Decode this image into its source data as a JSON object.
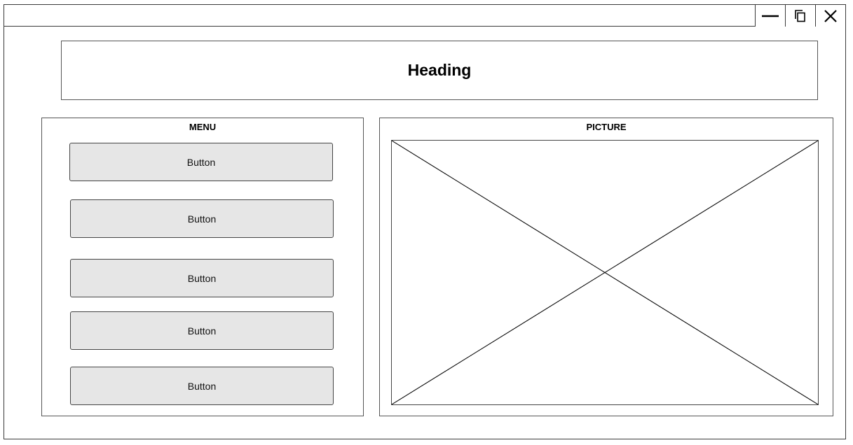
{
  "window": {
    "controls": {
      "minimize": "minimize-icon",
      "restore": "restore-icon",
      "close": "close-icon"
    }
  },
  "heading": {
    "text": "Heading"
  },
  "menu": {
    "title": "MENU",
    "buttons": [
      {
        "label": "Button"
      },
      {
        "label": "Button"
      },
      {
        "label": "Button"
      },
      {
        "label": "Button"
      },
      {
        "label": "Button"
      }
    ]
  },
  "picture": {
    "title": "PICTURE",
    "placeholder_icon": "image-placeholder-icon"
  }
}
